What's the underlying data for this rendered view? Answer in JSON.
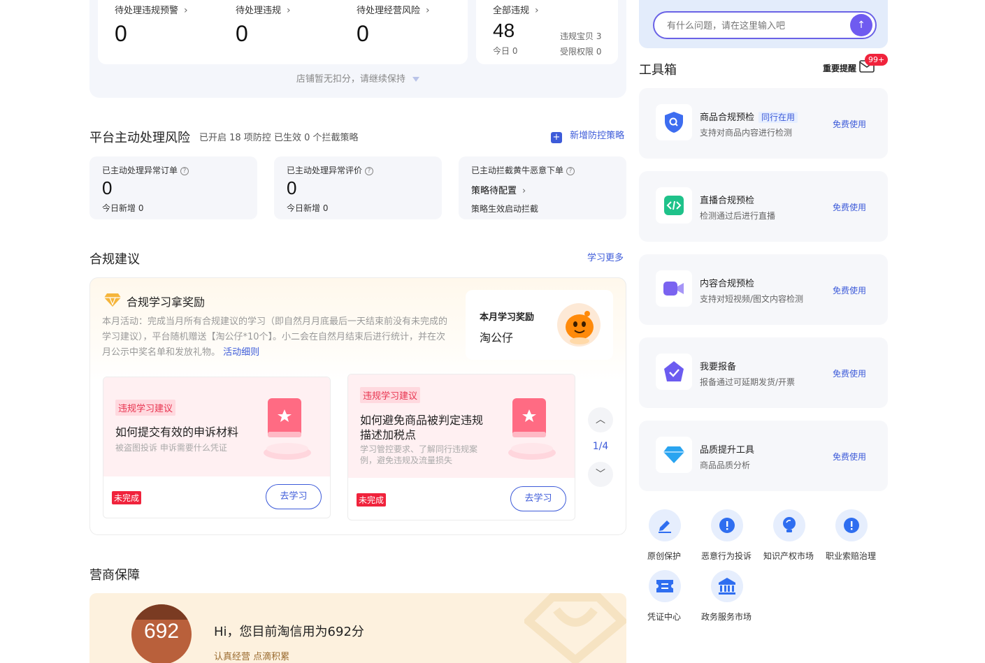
{
  "stats": [
    {
      "label": "待处理违规预警",
      "value": "0"
    },
    {
      "label": "待处理违规",
      "value": "0"
    },
    {
      "label": "待处理经营风险",
      "value": "0"
    }
  ],
  "all_violations": {
    "label": "全部违规",
    "value": "48",
    "today": "今日 0",
    "items_label": "违规宝贝 3",
    "restricted_label": "受限权限 0"
  },
  "store_tip": "店铺暂无扣分，请继续保持",
  "platform_risk": {
    "title": "平台主动处理风险",
    "subtitle": "已开启 18 项防控 已生效 0 个拦截策略",
    "add_label": "新增防控策略",
    "cards": [
      {
        "label": "已主动处理异常订单",
        "value": "0",
        "note": "今日新增 0"
      },
      {
        "label": "已主动处理异常评价",
        "value": "0",
        "note": "今日新增 0"
      },
      {
        "label": "已主动拦截黄牛恶意下单",
        "status": "策略待配置",
        "note": "策略生效启动拦截"
      }
    ]
  },
  "compliance": {
    "title": "合规建议",
    "more_label": "学习更多",
    "reward_title": "合规学习拿奖励",
    "reward_desc": "本月活动：完成当月所有合规建议的学习（即自然月月底最后一天结束前没有未完成的学习建议），平台随机赠送【淘公仔*10个】。小二会在自然月结束后进行统计，并在次月公示中奖名单和发放礼物。",
    "reward_link": "活动细则",
    "month_reward_label": "本月学习奖励",
    "month_reward_value": "淘公仔",
    "pager": "1/4",
    "lessons": [
      {
        "tag": "违规学习建议",
        "title": "如何提交有效的申诉材料",
        "desc": "被盗图投诉 申诉需要什么凭证",
        "status": "未完成",
        "action": "去学习"
      },
      {
        "tag": "违规学习建议",
        "title": "如何避免商品被判定违规描述加税点",
        "desc": "学习管控要求、了解同行违规案例，避免违规及流量损失",
        "status": "未完成",
        "action": "去学习"
      }
    ]
  },
  "credit": {
    "title": "营商保障",
    "score": "692",
    "greeting": "Hi，您目前淘信用为692分",
    "slogan": "认真经营 点滴积累"
  },
  "assistant": {
    "placeholder": "有什么问题，请在这里输入吧"
  },
  "toolbox": {
    "title": "工具箱",
    "notice_label": "重要提醒",
    "badge": "99+",
    "tools": [
      {
        "title": "商品合规预检",
        "tag": "同行在用",
        "desc": "支持对商品内容进行检测",
        "action": "免费使用",
        "icon": "shield-search-icon",
        "color": "#3d6df0"
      },
      {
        "title": "直播合规预检",
        "desc": "检测通过后进行直播",
        "action": "免费使用",
        "icon": "code-icon",
        "color": "#1fc28a"
      },
      {
        "title": "内容合规预检",
        "desc": "支持对短视频/图文内容检测",
        "action": "免费使用",
        "icon": "video-icon",
        "color": "#7a63f0"
      },
      {
        "title": "我要报备",
        "desc": "报备通过可延期发货/开票",
        "action": "免费使用",
        "icon": "badge-check-icon",
        "color": "#6c5cf0"
      },
      {
        "title": "品质提升工具",
        "desc": "商品品质分析",
        "action": "免费使用",
        "icon": "diamond-icon",
        "color": "#2aa4f0"
      }
    ],
    "quick_links": [
      {
        "label": "原创保护",
        "icon": "edit-icon"
      },
      {
        "label": "恶意行为投诉",
        "icon": "alert-icon"
      },
      {
        "label": "知识产权市场",
        "icon": "bulb-icon"
      },
      {
        "label": "职业索赔治理",
        "icon": "alert-icon"
      },
      {
        "label": "凭证中心",
        "icon": "ticket-icon"
      },
      {
        "label": "政务服务市场",
        "icon": "bank-icon"
      }
    ]
  }
}
